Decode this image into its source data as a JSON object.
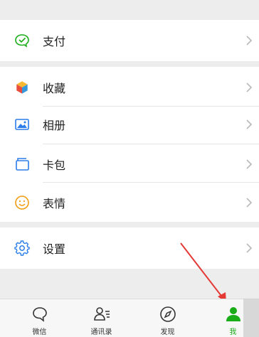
{
  "menu": {
    "pay": {
      "label": "支付",
      "icon": "wechat-pay-icon"
    },
    "favorites": {
      "label": "收藏",
      "icon": "favorites-cube-icon"
    },
    "album": {
      "label": "相册",
      "icon": "album-image-icon"
    },
    "cards": {
      "label": "卡包",
      "icon": "card-wallet-icon"
    },
    "stickers": {
      "label": "表情",
      "icon": "smiley-icon"
    },
    "settings": {
      "label": "设置",
      "icon": "gear-icon"
    }
  },
  "tabbar": {
    "chats": {
      "label": "微信",
      "icon": "chat-bubble-icon"
    },
    "contacts": {
      "label": "通讯录",
      "icon": "contacts-icon"
    },
    "discover": {
      "label": "发现",
      "icon": "compass-icon"
    },
    "me": {
      "label": "我",
      "icon": "person-icon",
      "active": true
    }
  },
  "colors": {
    "accent_green": "#1aad19",
    "background": "#ededed",
    "annotation_red": "#e53935"
  }
}
